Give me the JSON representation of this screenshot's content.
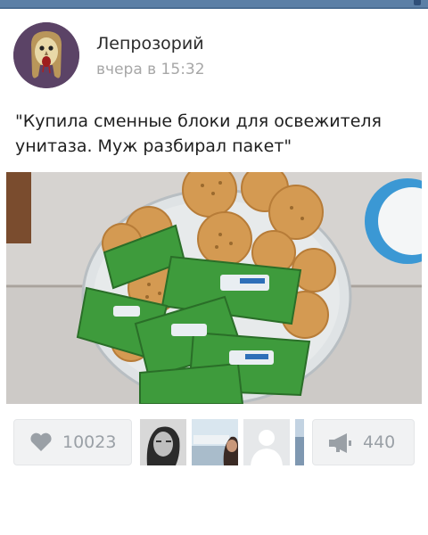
{
  "post": {
    "author": "Лепрозорий",
    "time": "вчера в 15:32",
    "text": "\"Купила сменные блоки для освежителя унитаза. Муж разбирал пакет\""
  },
  "icons": {
    "avatar": "skull-face-avatar",
    "like": "heart-icon",
    "share": "megaphone-icon"
  },
  "actions": {
    "likes": "10023",
    "shares": "440"
  },
  "likers": [
    "liker-avatar-woman",
    "liker-avatar-seaside",
    "liker-avatar-placeholder",
    "liker-avatar-partial"
  ],
  "colors": {
    "header_bar": "#5b7fa6",
    "button_bg": "#f1f2f3",
    "muted_text": "#9aa0a6"
  }
}
